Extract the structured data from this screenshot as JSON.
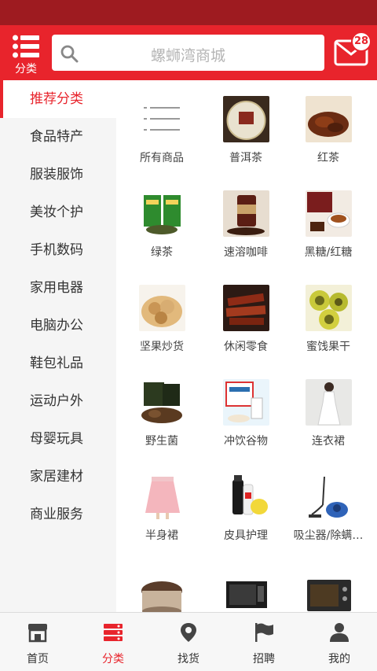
{
  "header": {
    "category_label": "分类",
    "search_placeholder": "螺蛳湾商城",
    "message_count": "28"
  },
  "sidebar": {
    "items": [
      {
        "label": "推荐分类",
        "active": true
      },
      {
        "label": "食品特产"
      },
      {
        "label": "服装服饰"
      },
      {
        "label": "美妆个护"
      },
      {
        "label": "手机数码"
      },
      {
        "label": "家用电器"
      },
      {
        "label": "电脑办公"
      },
      {
        "label": "鞋包礼品"
      },
      {
        "label": "运动户外"
      },
      {
        "label": "母婴玩具"
      },
      {
        "label": "家居建材"
      },
      {
        "label": "商业服务"
      }
    ]
  },
  "products": [
    {
      "name": "所有商品",
      "icon": "list-icon"
    },
    {
      "name": "普洱茶",
      "icon": "puer-tea-image"
    },
    {
      "name": "红茶",
      "icon": "black-tea-image"
    },
    {
      "name": "绿茶",
      "icon": "green-tea-image"
    },
    {
      "name": "速溶咖啡",
      "icon": "instant-coffee-image"
    },
    {
      "name": "黑糖/红糖",
      "icon": "brown-sugar-image"
    },
    {
      "name": "坚果炒货",
      "icon": "nuts-image"
    },
    {
      "name": "休闲零食",
      "icon": "snack-image"
    },
    {
      "name": "蜜饯果干",
      "icon": "dried-fruit-image"
    },
    {
      "name": "野生菌",
      "icon": "wild-mushroom-image"
    },
    {
      "name": "冲饮谷物",
      "icon": "cereal-drink-image"
    },
    {
      "name": "连衣裙",
      "icon": "dress-image"
    },
    {
      "name": "半身裙",
      "icon": "skirt-image"
    },
    {
      "name": "皮具护理",
      "icon": "leather-care-image"
    },
    {
      "name": "吸尘器/除螨…",
      "icon": "vacuum-cleaner-image"
    },
    {
      "name": "",
      "icon": "rice-cooker-image"
    },
    {
      "name": "",
      "icon": "microwave-image"
    },
    {
      "name": "",
      "icon": "oven-image"
    }
  ],
  "tabbar": {
    "tabs": [
      {
        "label": "首页",
        "icon": "store-icon"
      },
      {
        "label": "分类",
        "icon": "category-icon",
        "active": true
      },
      {
        "label": "找货",
        "icon": "location-pin-icon"
      },
      {
        "label": "招聘",
        "icon": "flag-icon"
      },
      {
        "label": "我的",
        "icon": "user-icon"
      }
    ]
  },
  "colors": {
    "brand_red": "#e8242c",
    "status_bar": "#9e1b20"
  }
}
